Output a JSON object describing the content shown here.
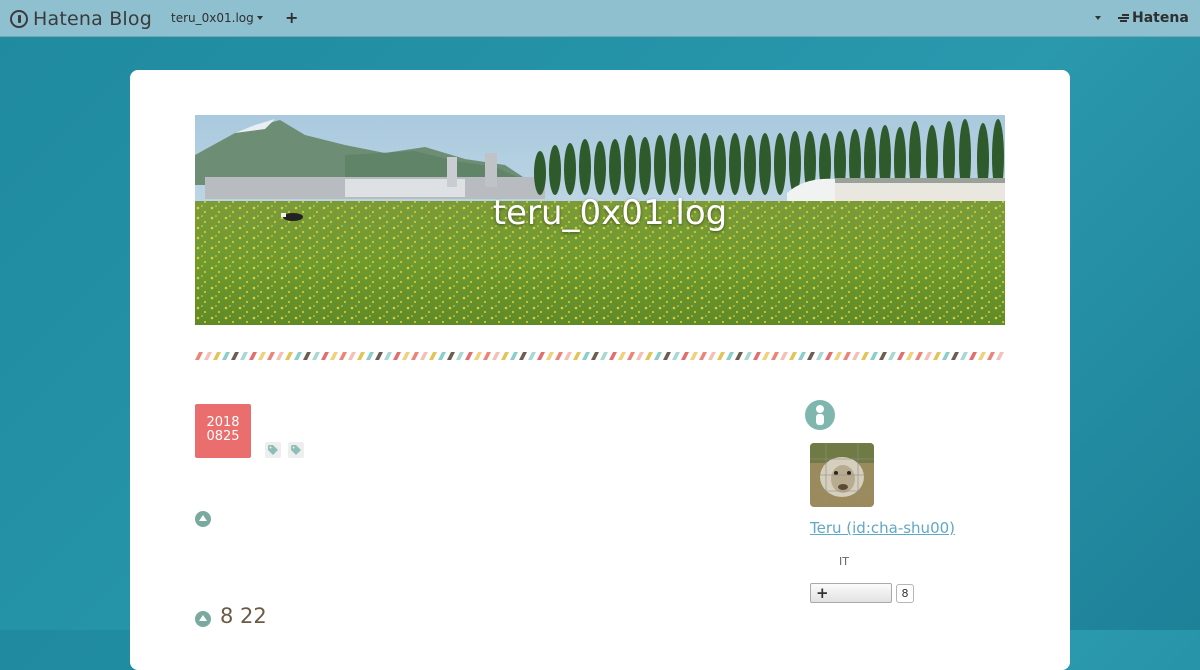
{
  "topbar": {
    "brand": "Hatena Blog",
    "blog_selector": "teru_0x01.log",
    "add_symbol": "+",
    "account_brand": "Hatena"
  },
  "blog": {
    "title": "teru_0x01.log"
  },
  "entry": {
    "date_year": "2018",
    "date_monthday": "0825",
    "section_heading": "8 22"
  },
  "sidebar": {
    "profile_name": "Teru (id:cha-shu00)",
    "profile_desc": "IT",
    "subscribe_label": "+",
    "subscribe_count": "8"
  },
  "colors": {
    "topbar": "#8ec0d0",
    "background": "#2593a8",
    "date_badge": "#ea6e6e",
    "accent_teal": "#7aa9a0",
    "link": "#5fa8c6"
  }
}
